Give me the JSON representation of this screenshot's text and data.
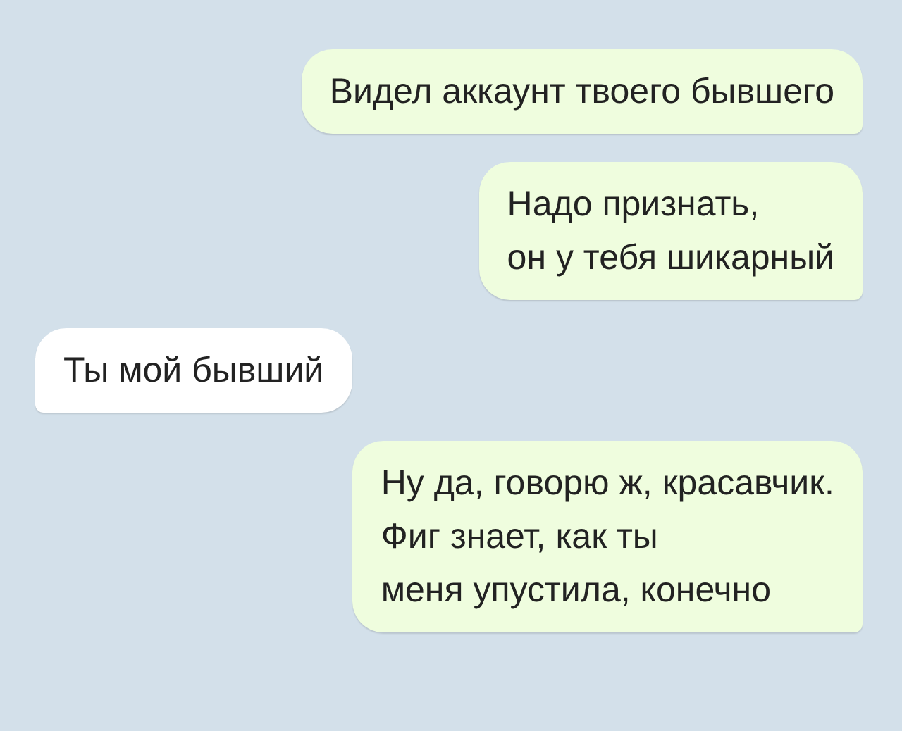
{
  "messages": [
    {
      "text": "Видел аккаунт твоего бывшего",
      "outgoing": true
    },
    {
      "text": "Надо признать,\nон у тебя шикарный",
      "outgoing": true
    },
    {
      "text": "Ты мой бывший",
      "outgoing": false
    },
    {
      "text": "Ну да, говорю ж, красавчик.\nФиг знает, как ты\nменя упустила, конечно",
      "outgoing": true
    }
  ]
}
